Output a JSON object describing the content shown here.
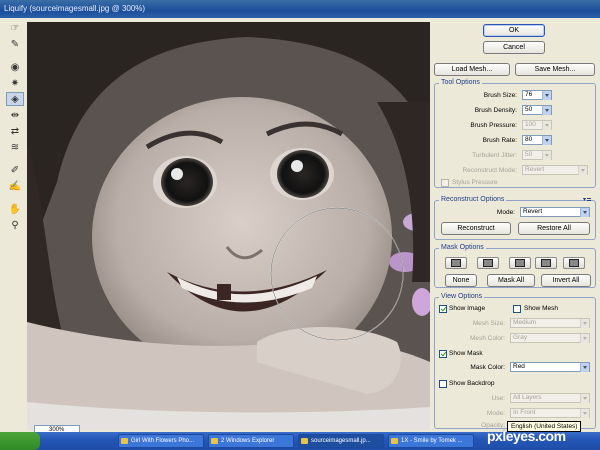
{
  "window": {
    "title": "Liquify (sourceimagesmall.jpg @ 300%)"
  },
  "tools": [
    "warp-icon",
    "reconstruct-icon",
    "twirl-icon",
    "pucker-icon",
    "bloat-icon",
    "push-left-icon",
    "mirror-icon",
    "turbulence-icon",
    "freeze-mask-icon",
    "thaw-mask-icon",
    "hand-icon",
    "zoom-icon"
  ],
  "buttons": {
    "ok": "OK",
    "cancel": "Cancel",
    "load_mesh": "Load Mesh...",
    "save_mesh": "Save Mesh..."
  },
  "tool_options": {
    "title": "Tool Options",
    "brush_size": {
      "label": "Brush Size:",
      "value": "76"
    },
    "brush_density": {
      "label": "Brush Density:",
      "value": "50"
    },
    "brush_pressure": {
      "label": "Brush Pressure:",
      "value": "100"
    },
    "brush_rate": {
      "label": "Brush Rate:",
      "value": "80"
    },
    "turbulent_jitter": {
      "label": "Turbulent Jitter:",
      "value": "50"
    },
    "reconstruct_mode": {
      "label": "Reconstruct Mode:",
      "value": "Revert"
    },
    "stylus_pressure": "Stylus Pressure"
  },
  "reconstruct_options": {
    "title": "Reconstruct Options",
    "mode_label": "Mode:",
    "mode_value": "Revert",
    "reconstruct": "Reconstruct",
    "restore_all": "Restore All"
  },
  "mask_options": {
    "title": "Mask Options",
    "none": "None",
    "mask_all": "Mask All",
    "invert_all": "Invert All"
  },
  "view_options": {
    "title": "View Options",
    "show_image": "Show Image",
    "show_mesh": "Show Mesh",
    "mesh_size": {
      "label": "Mesh Size:",
      "value": "Medium"
    },
    "mesh_color": {
      "label": "Mesh Color:",
      "value": "Gray"
    },
    "show_mask": "Show Mask",
    "mask_color": {
      "label": "Mask Color:",
      "value": "Red"
    },
    "show_backdrop": "Show Backdrop",
    "use": {
      "label": "Use:",
      "value": "All Layers"
    },
    "mode": {
      "label": "Mode:",
      "value": "In Front"
    },
    "opacity": {
      "label": "Opacity:"
    }
  },
  "statusbar": {
    "zoom": "300%"
  },
  "taskbar": {
    "items": [
      "Girl With Flowers Pho...",
      "2 Windows Explorer",
      "sourceimagesmall.jp...",
      "1X - Smile by Tomek ..."
    ]
  },
  "tooltip": "English (United States)",
  "watermark": "pxleyes.com",
  "colors": {
    "accent": "#0a246a",
    "group_title": "#1f3e8c",
    "checkbox_tick": "#21a121"
  }
}
